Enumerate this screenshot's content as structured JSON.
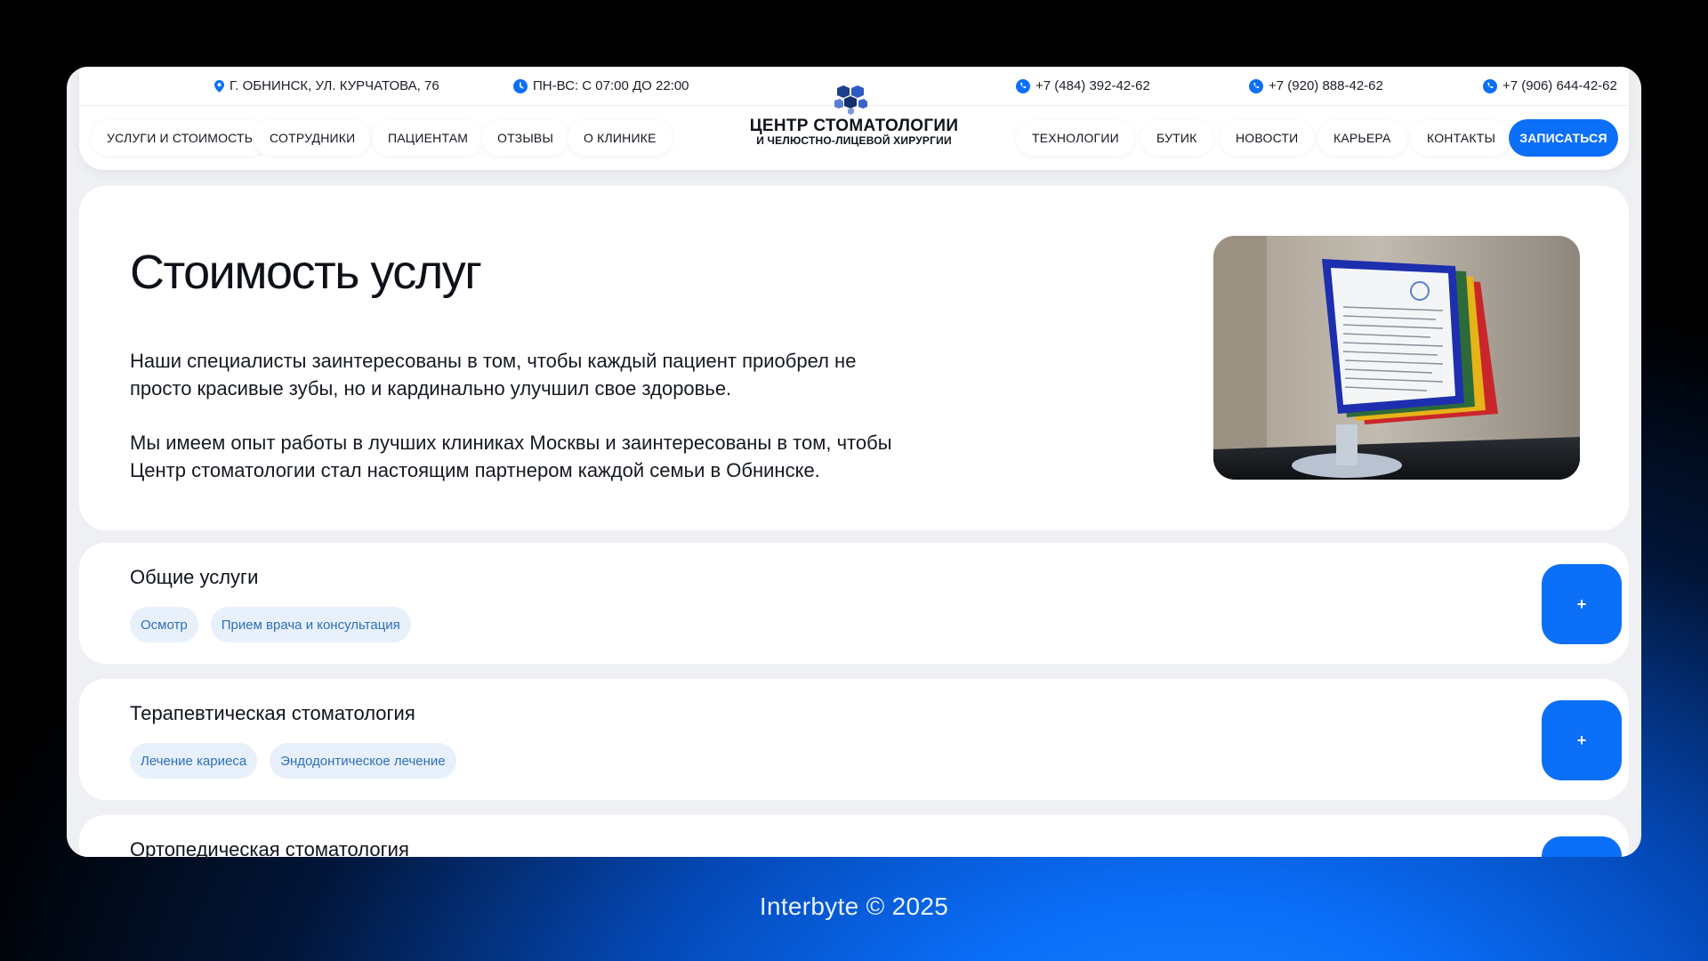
{
  "header": {
    "address": "Г. ОБНИНСК, УЛ. КУРЧАТОВА, 76",
    "hours": "ПН-ВС: С 07:00 ДО 22:00",
    "phones": [
      "+7 (484) 392-42-62",
      "+7 (920) 888-42-62",
      "+7 (906) 644-42-62"
    ],
    "logo": {
      "line1": "ЦЕНТР СТОМАТОЛОГИИ",
      "line2": "И ЧЕЛЮСТНО-ЛИЦЕВОЙ ХИРУРГИИ"
    },
    "nav_left": [
      "УСЛУГИ И СТОИМОСТЬ",
      "СОТРУДНИКИ",
      "ПАЦИЕНТАМ",
      "ОТЗЫВЫ",
      "О КЛИНИКЕ"
    ],
    "nav_right": [
      "ТЕХНОЛОГИИ",
      "БУТИК",
      "НОВОСТИ",
      "КАРЬЕРА",
      "КОНТАКТЫ"
    ],
    "cta": "ЗАПИСАТЬСЯ",
    "accent": "#0c6ff7"
  },
  "hero": {
    "title": "Стоимость услуг",
    "paragraph1_line1": "Наши специалисты заинтересованы в том, чтобы каждый пациент приобрел не",
    "paragraph1_line2": "просто красивые зубы, но и кардинально улучшил свое здоровье.",
    "paragraph2_line1": "Мы имеем опыт работы в лучших клиниках Москвы и заинтересованы в том, чтобы",
    "paragraph2_line2": "Центр стоматологии стал настоящим партнером каждой семьи в Обнинске."
  },
  "categories": [
    {
      "title": "Общие услуги",
      "tags": [
        "Осмотр",
        "Прием врача и консультация"
      ],
      "expand": "+"
    },
    {
      "title": "Терапевтическая стоматология",
      "tags": [
        "Лечение кариеса",
        "Эндодонтическое лечение"
      ],
      "expand": "+"
    },
    {
      "title": "Ортопедическая стоматология",
      "tags": [],
      "expand": "+"
    }
  ],
  "footer": "Interbyte © 2025"
}
